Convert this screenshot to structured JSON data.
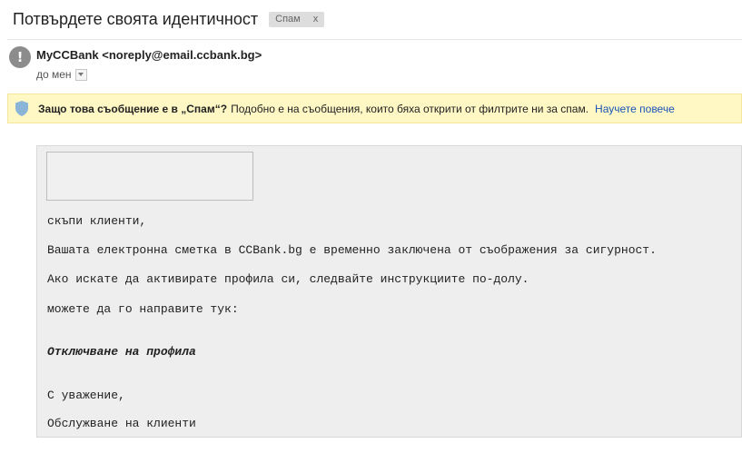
{
  "email": {
    "subject": "Потвърдете своята идентичност",
    "label": {
      "name": "Спам",
      "remove": "x"
    },
    "sender": {
      "avatar_glyph": "!",
      "name": "MyCCBank",
      "email": "<noreply@email.ccbank.bg>"
    },
    "recipient": {
      "text": "до мен"
    }
  },
  "spam_banner": {
    "question": "Защо това съобщение е в „Спам“?",
    "text": "Подобно е на съобщения, които бяха открити от филтрите ни за спам.",
    "learn_more": "Научете повече"
  },
  "body": {
    "greeting": "скъпи клиенти,",
    "line1": "Вашата електронна сметка в CCBank.bg е временно заключена от съображения за сигурност.",
    "line2": "Ако искате да активирате профила си, следвайте инструкциите по-долу.",
    "line3": "можете да го направите тук:",
    "link": "Отключване на профила",
    "regards": "С уважение,",
    "signature": "Обслужване на клиенти"
  },
  "colors": {
    "banner_bg": "#fff8c5",
    "link": "#1a55b8",
    "avatar": "#8c8c8c",
    "message_bg": "#eeeeee"
  }
}
